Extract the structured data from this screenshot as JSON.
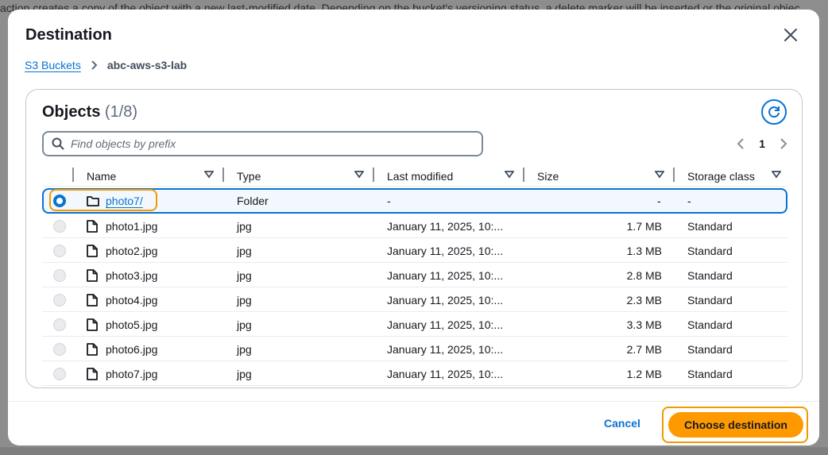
{
  "background": {
    "text": "action creates a copy of the object with a new last-modified date. Depending on the bucket's versioning status, a delete marker will be inserted or the original objec"
  },
  "modal": {
    "title": "Destination",
    "close_icon": "close-icon"
  },
  "breadcrumb": {
    "root": "S3 Buckets",
    "current": "abc-aws-s3-lab"
  },
  "objects": {
    "title": "Objects",
    "count": "(1/8)",
    "search_placeholder": "Find objects by prefix",
    "page": "1"
  },
  "table": {
    "columns": [
      "Name",
      "Type",
      "Last modified",
      "Size",
      "Storage class"
    ],
    "rows": [
      {
        "name": "photo7/",
        "type": "Folder",
        "modified": "-",
        "size": "-",
        "storage": "-",
        "icon": "folder-icon",
        "selected": true
      },
      {
        "name": "photo1.jpg",
        "type": "jpg",
        "modified": "January 11, 2025, 10:...",
        "size": "1.7 MB",
        "storage": "Standard",
        "icon": "file-icon"
      },
      {
        "name": "photo2.jpg",
        "type": "jpg",
        "modified": "January 11, 2025, 10:...",
        "size": "1.3 MB",
        "storage": "Standard",
        "icon": "file-icon"
      },
      {
        "name": "photo3.jpg",
        "type": "jpg",
        "modified": "January 11, 2025, 10:...",
        "size": "2.8 MB",
        "storage": "Standard",
        "icon": "file-icon"
      },
      {
        "name": "photo4.jpg",
        "type": "jpg",
        "modified": "January 11, 2025, 10:...",
        "size": "2.3 MB",
        "storage": "Standard",
        "icon": "file-icon"
      },
      {
        "name": "photo5.jpg",
        "type": "jpg",
        "modified": "January 11, 2025, 10:...",
        "size": "3.3 MB",
        "storage": "Standard",
        "icon": "file-icon"
      },
      {
        "name": "photo6.jpg",
        "type": "jpg",
        "modified": "January 11, 2025, 10:...",
        "size": "2.7 MB",
        "storage": "Standard",
        "icon": "file-icon"
      },
      {
        "name": "photo7.jpg",
        "type": "jpg",
        "modified": "January 11, 2025, 10:...",
        "size": "1.2 MB",
        "storage": "Standard",
        "icon": "file-icon"
      }
    ]
  },
  "footer": {
    "cancel": "Cancel",
    "choose": "Choose destination"
  },
  "colors": {
    "accent": "#0972d3",
    "primary_button": "#ff9900",
    "highlight": "#f29a00"
  }
}
